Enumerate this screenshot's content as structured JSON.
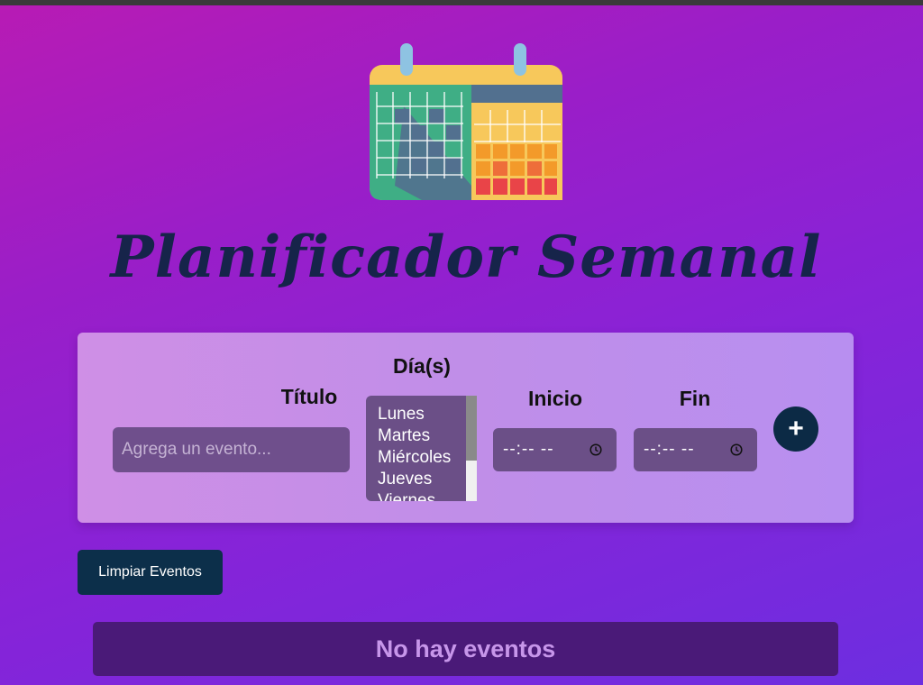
{
  "app": {
    "title": "Planificador Semanal"
  },
  "form": {
    "titulo_label": "Título",
    "titulo_placeholder": "Agrega un evento...",
    "dias_label": "Día(s)",
    "dias_options": [
      "Lunes",
      "Martes",
      "Miércoles",
      "Jueves",
      "Viernes"
    ],
    "inicio_label": "Inicio",
    "inicio_value": "--:-- --",
    "fin_label": "Fin",
    "fin_value": "--:-- --",
    "add_label": "+"
  },
  "actions": {
    "clear_label": "Limpiar Eventos"
  },
  "events": {
    "empty_message": "No hay eventos"
  },
  "icons": {
    "logo": "calendar-icon",
    "add": "plus-icon",
    "clock": "clock-icon"
  },
  "colors": {
    "title": "#16244a",
    "button_dark": "#0c2f4a",
    "panel": "#c08ee8",
    "empty_bg": "#4a1a78"
  }
}
